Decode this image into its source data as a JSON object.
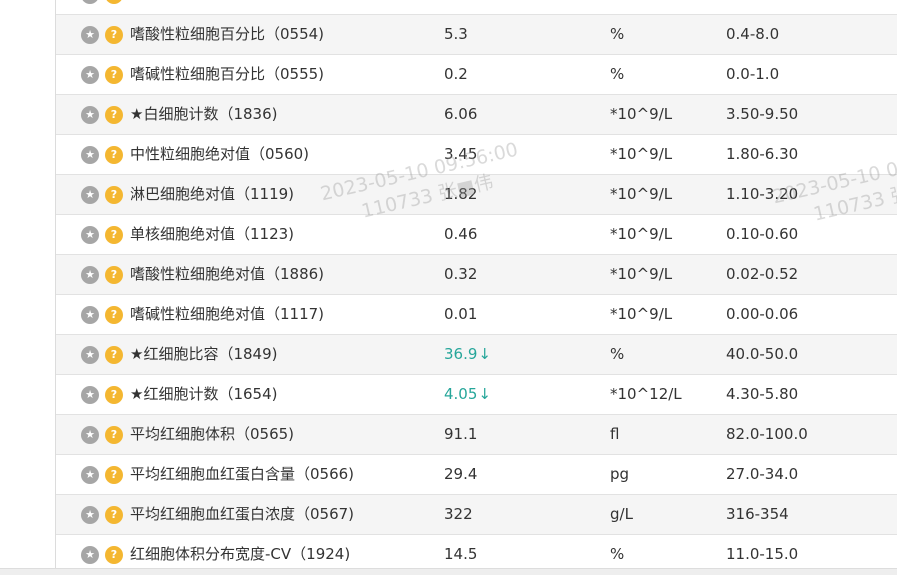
{
  "results": {
    "rows": [
      {
        "name": "",
        "value": "",
        "unit": "",
        "range": "",
        "flag": ""
      },
      {
        "name": "嗜酸性粒细胞百分比（0554)",
        "value": "5.3",
        "unit": "%",
        "range": "0.4-8.0",
        "flag": ""
      },
      {
        "name": "嗜碱性粒细胞百分比（0555)",
        "value": "0.2",
        "unit": "%",
        "range": "0.0-1.0",
        "flag": ""
      },
      {
        "name": "★白细胞计数（1836)",
        "value": "6.06",
        "unit": "*10^9/L",
        "range": "3.50-9.50",
        "flag": ""
      },
      {
        "name": "中性粒细胞绝对值（0560)",
        "value": "3.45",
        "unit": "*10^9/L",
        "range": "1.80-6.30",
        "flag": ""
      },
      {
        "name": "淋巴细胞绝对值（1119)",
        "value": "1.82",
        "unit": "*10^9/L",
        "range": "1.10-3.20",
        "flag": ""
      },
      {
        "name": "单核细胞绝对值（1123)",
        "value": "0.46",
        "unit": "*10^9/L",
        "range": "0.10-0.60",
        "flag": ""
      },
      {
        "name": "嗜酸性粒细胞绝对值（1886)",
        "value": "0.32",
        "unit": "*10^9/L",
        "range": "0.02-0.52",
        "flag": ""
      },
      {
        "name": "嗜碱性粒细胞绝对值（1117)",
        "value": "0.01",
        "unit": "*10^9/L",
        "range": "0.00-0.06",
        "flag": ""
      },
      {
        "name": "★红细胞比容（1849)",
        "value": "36.9",
        "unit": "%",
        "range": "40.0-50.0",
        "flag": "↓"
      },
      {
        "name": "★红细胞计数（1654)",
        "value": "4.05",
        "unit": "*10^12/L",
        "range": "4.30-5.80",
        "flag": "↓"
      },
      {
        "name": "平均红细胞体积（0565)",
        "value": "91.1",
        "unit": "fl",
        "range": "82.0-100.0",
        "flag": ""
      },
      {
        "name": "平均红细胞血红蛋白含量（0566)",
        "value": "29.4",
        "unit": "pg",
        "range": "27.0-34.0",
        "flag": ""
      },
      {
        "name": "平均红细胞血红蛋白浓度（0567)",
        "value": "322",
        "unit": "g/L",
        "range": "316-354",
        "flag": ""
      },
      {
        "name": "红细胞体积分布宽度-CV（1924)",
        "value": "14.5",
        "unit": "%",
        "range": "11.0-15.0",
        "flag": ""
      }
    ]
  },
  "icons": {
    "star": "star-icon",
    "help": "question-icon"
  },
  "icon_glyphs": {
    "star": "★",
    "help": "?"
  },
  "colors": {
    "low_flag": "#26a69a",
    "help_icon": "#f4b731",
    "star_icon": "#a6a6a6",
    "row_alt": "#f5f5f5"
  },
  "watermark": {
    "timestamp": "2023-05-10 09:56:00",
    "user": "110733 张■伟"
  }
}
